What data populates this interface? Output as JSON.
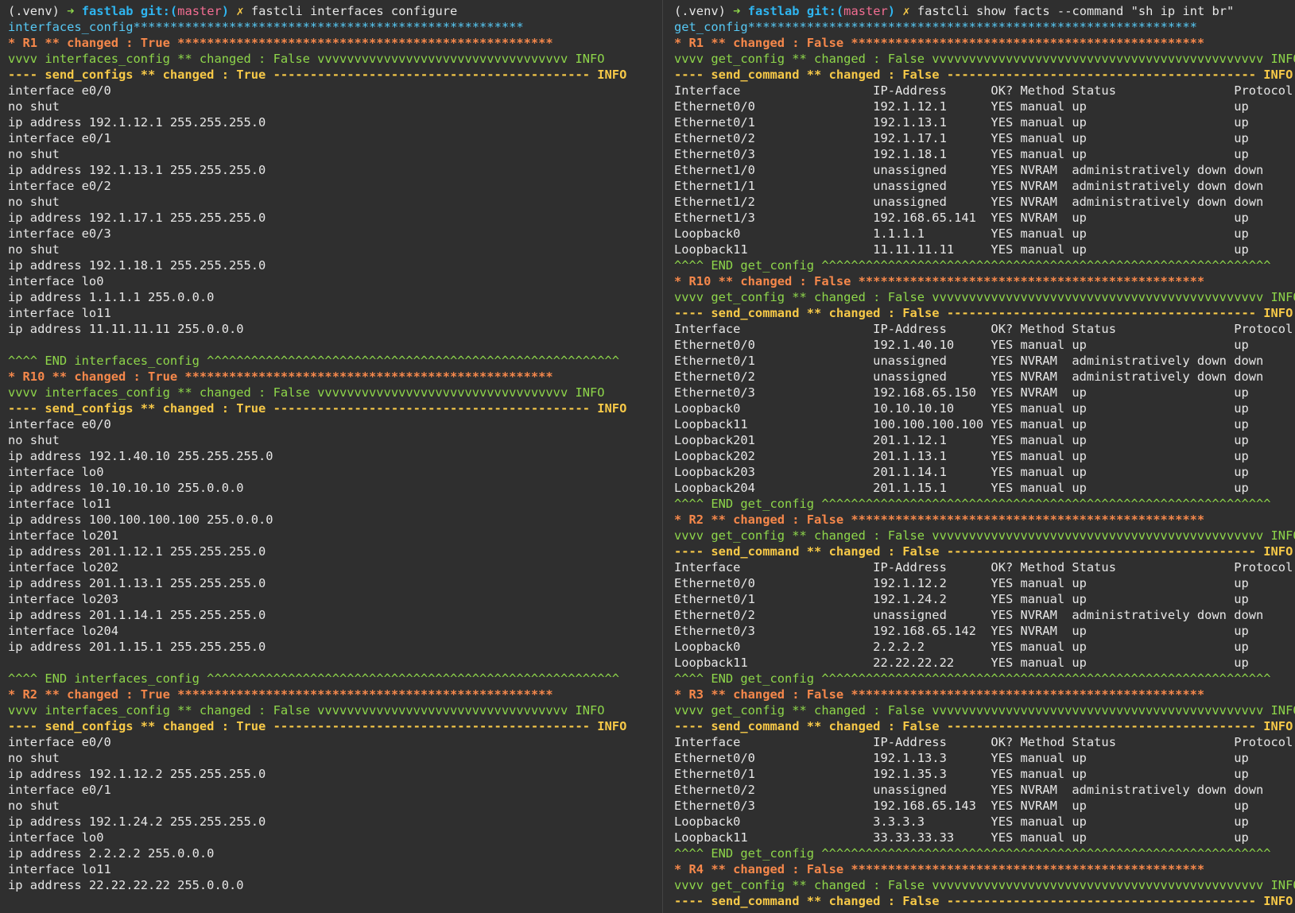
{
  "colors": {
    "background": "#2f2f2f",
    "text": "#e6e6e6",
    "cyan": "#56c8f4",
    "green": "#8ed64a",
    "blue": "#2fb5f0",
    "pink": "#f26d92",
    "orange": "#f6884b",
    "yellow": "#f7c948"
  },
  "left": {
    "lines": [
      [
        [
          "(.venv) ",
          "text"
        ],
        [
          "➜ ",
          "green"
        ],
        [
          "fastlab ",
          "blue"
        ],
        [
          "git:(",
          "blue"
        ],
        [
          "master",
          "pink"
        ],
        [
          ")",
          "blue"
        ],
        [
          " ✗ ",
          "yellow"
        ],
        [
          "fastcli interfaces configure",
          "text"
        ]
      ],
      [
        [
          "interfaces_config",
          "cyan"
        ],
        [
          "*****************************************************",
          "cyan"
        ]
      ],
      [
        [
          "* R1 ** changed : True ***************************************************",
          "orange"
        ]
      ],
      [
        [
          "vvvv interfaces_config ** changed : False vvvvvvvvvvvvvvvvvvvvvvvvvvvvvvvvvv INFO",
          "green"
        ]
      ],
      [
        [
          "---- send_configs ** changed : True ------------------------------------------- INFO",
          "yellow"
        ]
      ],
      [
        [
          "interface e0/0",
          "text"
        ]
      ],
      [
        [
          "no shut",
          "text"
        ]
      ],
      [
        [
          "ip address 192.1.12.1 255.255.255.0",
          "text"
        ]
      ],
      [
        [
          "interface e0/1",
          "text"
        ]
      ],
      [
        [
          "no shut",
          "text"
        ]
      ],
      [
        [
          "ip address 192.1.13.1 255.255.255.0",
          "text"
        ]
      ],
      [
        [
          "interface e0/2",
          "text"
        ]
      ],
      [
        [
          "no shut",
          "text"
        ]
      ],
      [
        [
          "ip address 192.1.17.1 255.255.255.0",
          "text"
        ]
      ],
      [
        [
          "interface e0/3",
          "text"
        ]
      ],
      [
        [
          "no shut",
          "text"
        ]
      ],
      [
        [
          "ip address 192.1.18.1 255.255.255.0",
          "text"
        ]
      ],
      [
        [
          "interface lo0",
          "text"
        ]
      ],
      [
        [
          "ip address 1.1.1.1 255.0.0.0",
          "text"
        ]
      ],
      [
        [
          "interface lo11",
          "text"
        ]
      ],
      [
        [
          "ip address 11.11.11.11 255.0.0.0",
          "text"
        ]
      ],
      [
        [
          "",
          "text"
        ]
      ],
      [
        [
          "^^^^ END interfaces_config ^^^^^^^^^^^^^^^^^^^^^^^^^^^^^^^^^^^^^^^^^^^^^^^^^^^^^^^^",
          "green"
        ]
      ],
      [
        [
          "* R10 ** changed : True **************************************************",
          "orange"
        ]
      ],
      [
        [
          "vvvv interfaces_config ** changed : False vvvvvvvvvvvvvvvvvvvvvvvvvvvvvvvvvv INFO",
          "green"
        ]
      ],
      [
        [
          "---- send_configs ** changed : True ------------------------------------------- INFO",
          "yellow"
        ]
      ],
      [
        [
          "interface e0/0",
          "text"
        ]
      ],
      [
        [
          "no shut",
          "text"
        ]
      ],
      [
        [
          "ip address 192.1.40.10 255.255.255.0",
          "text"
        ]
      ],
      [
        [
          "interface lo0",
          "text"
        ]
      ],
      [
        [
          "ip address 10.10.10.10 255.0.0.0",
          "text"
        ]
      ],
      [
        [
          "interface lo11",
          "text"
        ]
      ],
      [
        [
          "ip address 100.100.100.100 255.0.0.0",
          "text"
        ]
      ],
      [
        [
          "interface lo201",
          "text"
        ]
      ],
      [
        [
          "ip address 201.1.12.1 255.255.255.0",
          "text"
        ]
      ],
      [
        [
          "interface lo202",
          "text"
        ]
      ],
      [
        [
          "ip address 201.1.13.1 255.255.255.0",
          "text"
        ]
      ],
      [
        [
          "interface lo203",
          "text"
        ]
      ],
      [
        [
          "ip address 201.1.14.1 255.255.255.0",
          "text"
        ]
      ],
      [
        [
          "interface lo204",
          "text"
        ]
      ],
      [
        [
          "ip address 201.1.15.1 255.255.255.0",
          "text"
        ]
      ],
      [
        [
          "",
          "text"
        ]
      ],
      [
        [
          "^^^^ END interfaces_config ^^^^^^^^^^^^^^^^^^^^^^^^^^^^^^^^^^^^^^^^^^^^^^^^^^^^^^^^",
          "green"
        ]
      ],
      [
        [
          "* R2 ** changed : True ***************************************************",
          "orange"
        ]
      ],
      [
        [
          "vvvv interfaces_config ** changed : False vvvvvvvvvvvvvvvvvvvvvvvvvvvvvvvvvv INFO",
          "green"
        ]
      ],
      [
        [
          "---- send_configs ** changed : True ------------------------------------------- INFO",
          "yellow"
        ]
      ],
      [
        [
          "interface e0/0",
          "text"
        ]
      ],
      [
        [
          "no shut",
          "text"
        ]
      ],
      [
        [
          "ip address 192.1.12.2 255.255.255.0",
          "text"
        ]
      ],
      [
        [
          "interface e0/1",
          "text"
        ]
      ],
      [
        [
          "no shut",
          "text"
        ]
      ],
      [
        [
          "ip address 192.1.24.2 255.255.255.0",
          "text"
        ]
      ],
      [
        [
          "interface lo0",
          "text"
        ]
      ],
      [
        [
          "ip address 2.2.2.2 255.0.0.0",
          "text"
        ]
      ],
      [
        [
          "interface lo11",
          "text"
        ]
      ],
      [
        [
          "ip address 22.22.22.22 255.0.0.0",
          "text"
        ]
      ]
    ]
  },
  "right": {
    "lines": [
      [
        [
          "(.venv) ",
          "text"
        ],
        [
          "➜ ",
          "green"
        ],
        [
          "fastlab ",
          "blue"
        ],
        [
          "git:(",
          "blue"
        ],
        [
          "master",
          "pink"
        ],
        [
          ")",
          "blue"
        ],
        [
          " ✗ ",
          "yellow"
        ],
        [
          "fastcli show facts --command \"sh ip int br\"",
          "text"
        ]
      ],
      [
        [
          "get_config",
          "cyan"
        ],
        [
          "*************************************************************",
          "cyan"
        ]
      ],
      [
        [
          "* R1 ** changed : False ************************************************",
          "orange"
        ]
      ],
      [
        [
          "vvvv get_config ** changed : False vvvvvvvvvvvvvvvvvvvvvvvvvvvvvvvvvvvvvvvvvvvvv INFO",
          "green"
        ]
      ],
      [
        [
          "---- send_command ** changed : False ------------------------------------------ INFO",
          "yellow"
        ]
      ],
      [
        [
          "Interface                  IP-Address      OK? Method Status                Protocol",
          "text"
        ]
      ],
      [
        [
          "Ethernet0/0                192.1.12.1      YES manual up                    up",
          "text"
        ]
      ],
      [
        [
          "Ethernet0/1                192.1.13.1      YES manual up                    up",
          "text"
        ]
      ],
      [
        [
          "Ethernet0/2                192.1.17.1      YES manual up                    up",
          "text"
        ]
      ],
      [
        [
          "Ethernet0/3                192.1.18.1      YES manual up                    up",
          "text"
        ]
      ],
      [
        [
          "Ethernet1/0                unassigned      YES NVRAM  administratively down down",
          "text"
        ]
      ],
      [
        [
          "Ethernet1/1                unassigned      YES NVRAM  administratively down down",
          "text"
        ]
      ],
      [
        [
          "Ethernet1/2                unassigned      YES NVRAM  administratively down down",
          "text"
        ]
      ],
      [
        [
          "Ethernet1/3                192.168.65.141  YES NVRAM  up                    up",
          "text"
        ]
      ],
      [
        [
          "Loopback0                  1.1.1.1         YES manual up                    up",
          "text"
        ]
      ],
      [
        [
          "Loopback11                 11.11.11.11     YES manual up                    up",
          "text"
        ]
      ],
      [
        [
          "^^^^ END get_config ^^^^^^^^^^^^^^^^^^^^^^^^^^^^^^^^^^^^^^^^^^^^^^^^^^^^^^^^^^^^^",
          "green"
        ]
      ],
      [
        [
          "* R10 ** changed : False ***********************************************",
          "orange"
        ]
      ],
      [
        [
          "vvvv get_config ** changed : False vvvvvvvvvvvvvvvvvvvvvvvvvvvvvvvvvvvvvvvvvvvvv INFO",
          "green"
        ]
      ],
      [
        [
          "---- send_command ** changed : False ------------------------------------------ INFO",
          "yellow"
        ]
      ],
      [
        [
          "Interface                  IP-Address      OK? Method Status                Protocol",
          "text"
        ]
      ],
      [
        [
          "Ethernet0/0                192.1.40.10     YES manual up                    up",
          "text"
        ]
      ],
      [
        [
          "Ethernet0/1                unassigned      YES NVRAM  administratively down down",
          "text"
        ]
      ],
      [
        [
          "Ethernet0/2                unassigned      YES NVRAM  administratively down down",
          "text"
        ]
      ],
      [
        [
          "Ethernet0/3                192.168.65.150  YES NVRAM  up                    up",
          "text"
        ]
      ],
      [
        [
          "Loopback0                  10.10.10.10     YES manual up                    up",
          "text"
        ]
      ],
      [
        [
          "Loopback11                 100.100.100.100 YES manual up                    up",
          "text"
        ]
      ],
      [
        [
          "Loopback201                201.1.12.1      YES manual up                    up",
          "text"
        ]
      ],
      [
        [
          "Loopback202                201.1.13.1      YES manual up                    up",
          "text"
        ]
      ],
      [
        [
          "Loopback203                201.1.14.1      YES manual up                    up",
          "text"
        ]
      ],
      [
        [
          "Loopback204                201.1.15.1      YES manual up                    up",
          "text"
        ]
      ],
      [
        [
          "^^^^ END get_config ^^^^^^^^^^^^^^^^^^^^^^^^^^^^^^^^^^^^^^^^^^^^^^^^^^^^^^^^^^^^^",
          "green"
        ]
      ],
      [
        [
          "* R2 ** changed : False ************************************************",
          "orange"
        ]
      ],
      [
        [
          "vvvv get_config ** changed : False vvvvvvvvvvvvvvvvvvvvvvvvvvvvvvvvvvvvvvvvvvvvv INFO",
          "green"
        ]
      ],
      [
        [
          "---- send_command ** changed : False ------------------------------------------ INFO",
          "yellow"
        ]
      ],
      [
        [
          "Interface                  IP-Address      OK? Method Status                Protocol",
          "text"
        ]
      ],
      [
        [
          "Ethernet0/0                192.1.12.2      YES manual up                    up",
          "text"
        ]
      ],
      [
        [
          "Ethernet0/1                192.1.24.2      YES manual up                    up",
          "text"
        ]
      ],
      [
        [
          "Ethernet0/2                unassigned      YES NVRAM  administratively down down",
          "text"
        ]
      ],
      [
        [
          "Ethernet0/3                192.168.65.142  YES NVRAM  up                    up",
          "text"
        ]
      ],
      [
        [
          "Loopback0                  2.2.2.2         YES manual up                    up",
          "text"
        ]
      ],
      [
        [
          "Loopback11                 22.22.22.22     YES manual up                    up",
          "text"
        ]
      ],
      [
        [
          "^^^^ END get_config ^^^^^^^^^^^^^^^^^^^^^^^^^^^^^^^^^^^^^^^^^^^^^^^^^^^^^^^^^^^^^",
          "green"
        ]
      ],
      [
        [
          "* R3 ** changed : False ************************************************",
          "orange"
        ]
      ],
      [
        [
          "vvvv get_config ** changed : False vvvvvvvvvvvvvvvvvvvvvvvvvvvvvvvvvvvvvvvvvvvvv INFO",
          "green"
        ]
      ],
      [
        [
          "---- send_command ** changed : False ------------------------------------------ INFO",
          "yellow"
        ]
      ],
      [
        [
          "Interface                  IP-Address      OK? Method Status                Protocol",
          "text"
        ]
      ],
      [
        [
          "Ethernet0/0                192.1.13.3      YES manual up                    up",
          "text"
        ]
      ],
      [
        [
          "Ethernet0/1                192.1.35.3      YES manual up                    up",
          "text"
        ]
      ],
      [
        [
          "Ethernet0/2                unassigned      YES NVRAM  administratively down down",
          "text"
        ]
      ],
      [
        [
          "Ethernet0/3                192.168.65.143  YES NVRAM  up                    up",
          "text"
        ]
      ],
      [
        [
          "Loopback0                  3.3.3.3         YES manual up                    up",
          "text"
        ]
      ],
      [
        [
          "Loopback11                 33.33.33.33     YES manual up                    up",
          "text"
        ]
      ],
      [
        [
          "^^^^ END get_config ^^^^^^^^^^^^^^^^^^^^^^^^^^^^^^^^^^^^^^^^^^^^^^^^^^^^^^^^^^^^^",
          "green"
        ]
      ],
      [
        [
          "* R4 ** changed : False ************************************************",
          "orange"
        ]
      ],
      [
        [
          "vvvv get_config ** changed : False vvvvvvvvvvvvvvvvvvvvvvvvvvvvvvvvvvvvvvvvvvvvv INFO",
          "green"
        ]
      ],
      [
        [
          "---- send_command ** changed : False ------------------------------------------ INFO",
          "yellow"
        ]
      ]
    ]
  }
}
